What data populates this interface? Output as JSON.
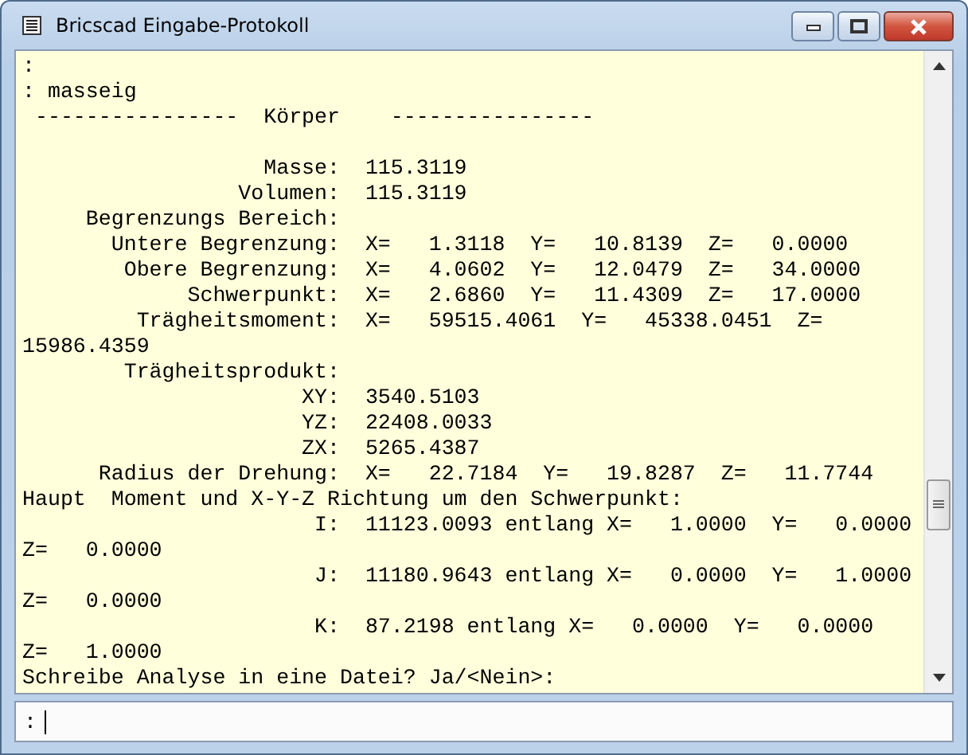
{
  "window": {
    "title": "Bricscad Eingabe-Protokoll"
  },
  "log": {
    "lines": [
      {
        "text": ":",
        "gap_before": false
      },
      {
        "text": ": masseig",
        "gap_before": false
      },
      {
        "text": " ----------------  Körper    ----------------",
        "gap_before": false
      },
      {
        "text": "                   Masse:  115.3119",
        "gap_before": true
      },
      {
        "text": "                 Volumen:  115.3119",
        "gap_before": false
      },
      {
        "text": "     Begrenzungs Bereich:",
        "gap_before": false
      },
      {
        "text": "       Untere Begrenzung:  X=   1.3118  Y=   10.8139  Z=   0.0000",
        "gap_before": false
      },
      {
        "text": "        Obere Begrenzung:  X=   4.0602  Y=   12.0479  Z=   34.0000",
        "gap_before": false
      },
      {
        "text": "             Schwerpunkt:  X=   2.6860  Y=   11.4309  Z=   17.0000",
        "gap_before": false
      },
      {
        "text": "         Trägheitsmoment:  X=   59515.4061  Y=   45338.0451  Z=",
        "gap_before": false
      },
      {
        "text": "15986.4359",
        "gap_before": false
      },
      {
        "text": "        Trägheitsprodukt:",
        "gap_before": false
      },
      {
        "text": "                      XY:  3540.5103",
        "gap_before": false
      },
      {
        "text": "                      YZ:  22408.0033",
        "gap_before": false
      },
      {
        "text": "                      ZX:  5265.4387",
        "gap_before": false
      },
      {
        "text": "      Radius der Drehung:  X=   22.7184  Y=   19.8287  Z=   11.7744",
        "gap_before": false
      },
      {
        "text": "Haupt  Moment und X-Y-Z Richtung um den Schwerpunkt:",
        "gap_before": false
      },
      {
        "text": "                       I:  11123.0093 entlang X=   1.0000  Y=   0.0000",
        "gap_before": false
      },
      {
        "text": "Z=   0.0000",
        "gap_before": false
      },
      {
        "text": "                       J:  11180.9643 entlang X=   0.0000  Y=   1.0000",
        "gap_before": false
      },
      {
        "text": "Z=   0.0000",
        "gap_before": false
      },
      {
        "text": "                       K:  87.2198 entlang X=   0.0000  Y=   0.0000",
        "gap_before": false
      },
      {
        "text": "Z=   1.0000",
        "gap_before": false
      },
      {
        "text": "Schreibe Analyse in eine Datei? Ja/<Nein>:",
        "gap_before": false
      }
    ]
  },
  "command_line": {
    "prompt": ":"
  }
}
